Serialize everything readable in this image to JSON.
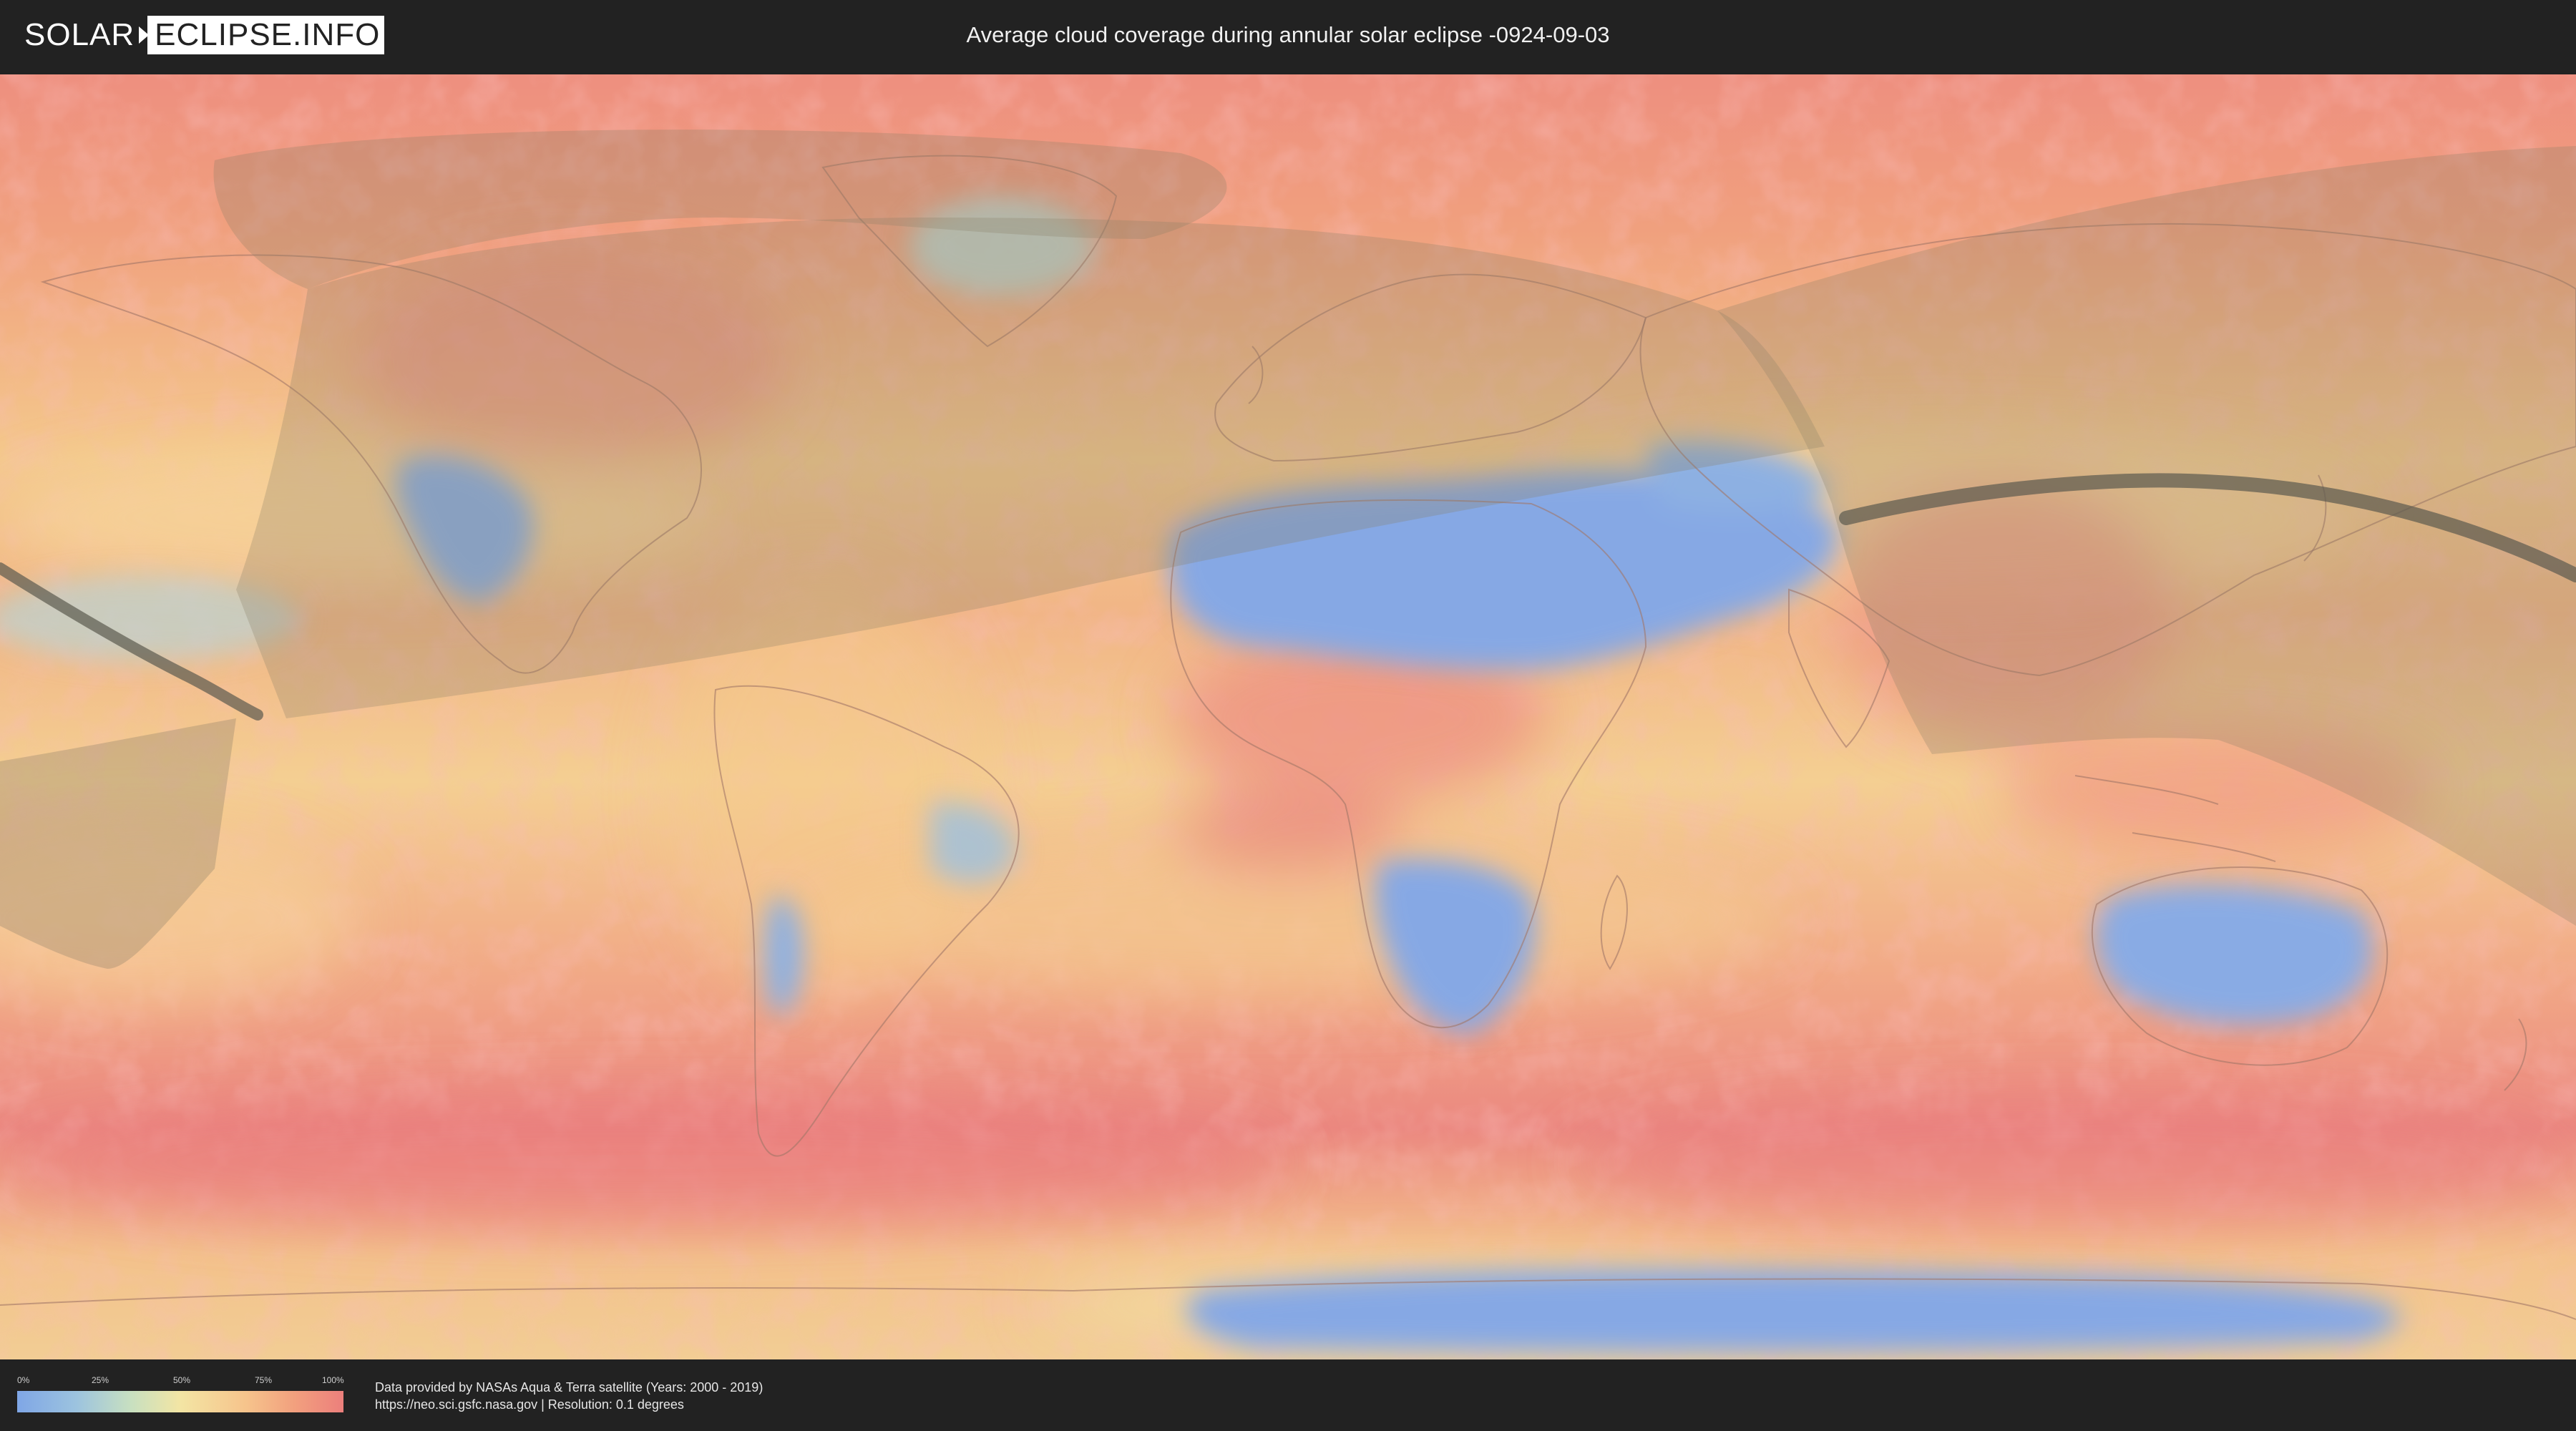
{
  "header": {
    "logo_left": "SOLAR",
    "logo_right": "ECLIPSE.INFO",
    "title": "Average cloud coverage during annular solar eclipse -0924-09-03"
  },
  "legend": {
    "ticks": [
      "0%",
      "25%",
      "50%",
      "75%",
      "100%"
    ],
    "colors": {
      "low": "#7fa6e6",
      "mid": "#f3e5a4",
      "high": "#ec7f7c"
    }
  },
  "footer": {
    "credit_line1": "Data provided by NASAs Aqua & Terra satellite (Years: 2000 - 2019)",
    "credit_line2": "https://neo.sci.gsfc.nasa.gov | Resolution: 0.1 degrees"
  },
  "map": {
    "projection": "equirectangular",
    "overlay": "eclipse visibility zone and central path"
  }
}
